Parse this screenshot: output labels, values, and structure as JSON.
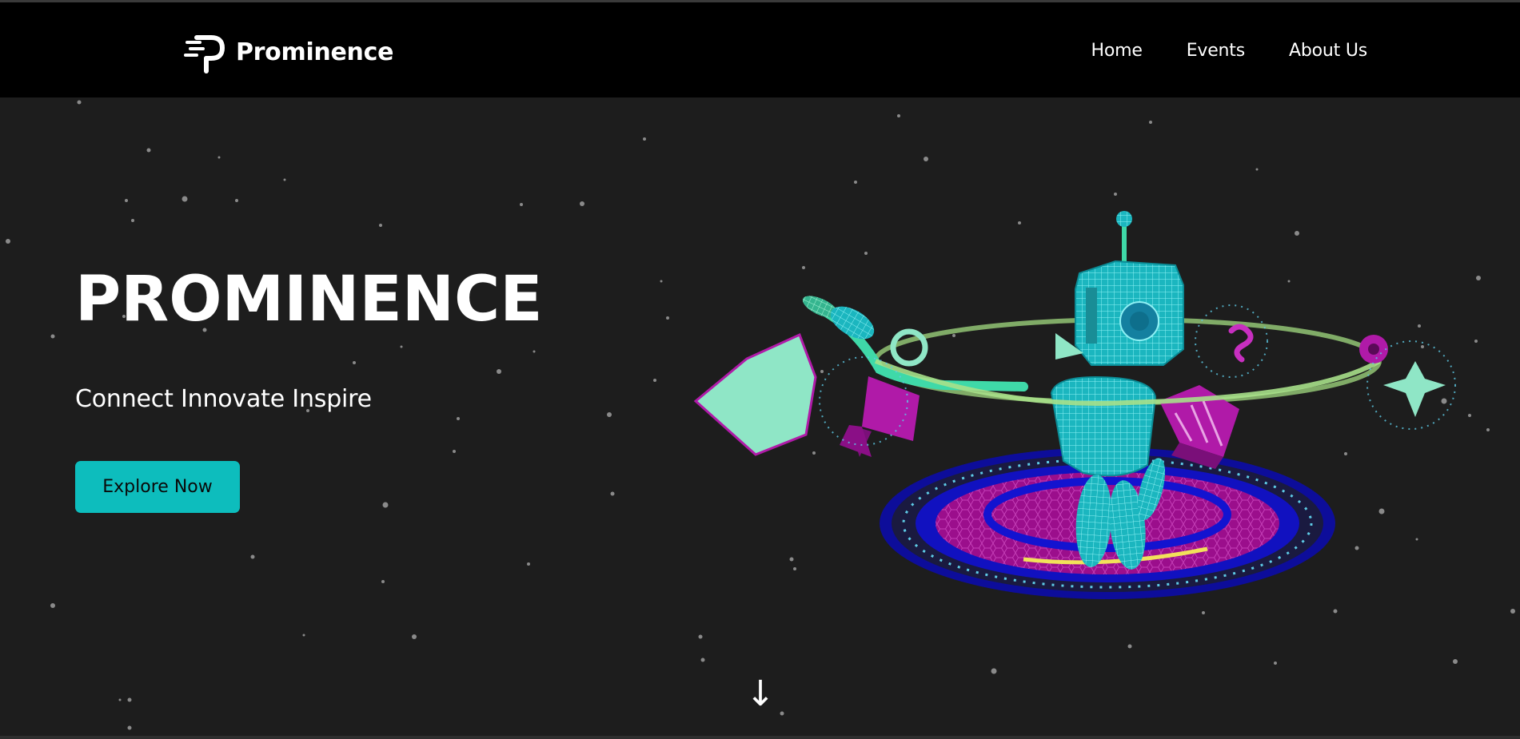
{
  "nav": {
    "brand": "Prominence",
    "logo_icon": "prominence-p-logo",
    "links": [
      "Home",
      "Events",
      "About Us"
    ]
  },
  "hero": {
    "title": "PROMINENCE",
    "tagline": "Connect Innovate Inspire",
    "cta_label": "Explore Now",
    "illustration": "wireframe-robot-on-hologram-pad",
    "scroll_icon": "arrow-down-icon",
    "scroll_glyph": "↓"
  },
  "colors": {
    "nav_bg": "#000000",
    "page_bg": "#1d1d1d",
    "accent": "#0dbdbd",
    "robot_cyan": "#2fd0d6",
    "mint": "#8fe6c6",
    "magenta": "#b01aa8",
    "pad_blue": "#1010b8"
  }
}
